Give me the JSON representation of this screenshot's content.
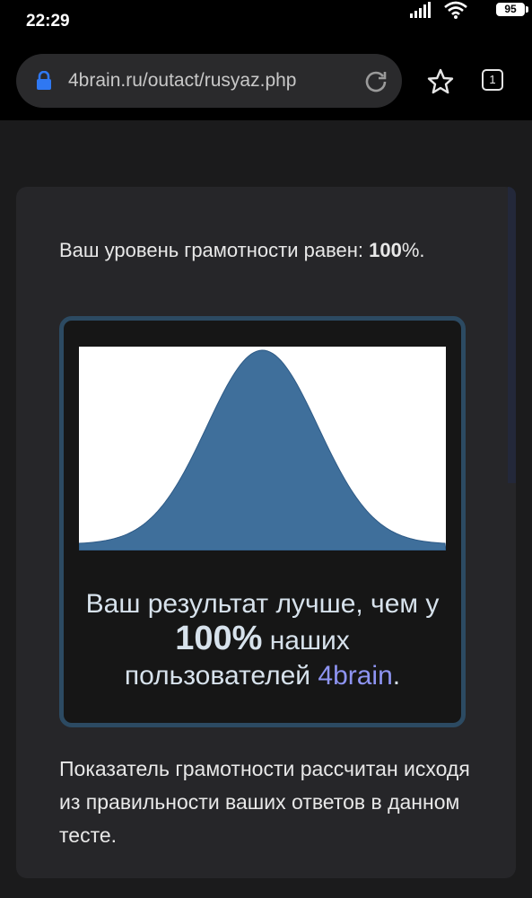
{
  "status_bar": {
    "time": "22:29",
    "battery": "95"
  },
  "browser": {
    "url": "4brain.ru/outact/rusyaz.php",
    "tab_count": "1"
  },
  "card": {
    "level_prefix": "Ваш уровень грамотности равен: ",
    "level_value": "100",
    "level_suffix": "%.",
    "result_line1": "Ваш результат лучше, чем у",
    "result_percent": "100%",
    "result_line2": "наших",
    "result_line3": "пользователей",
    "result_brand": "4brain",
    "result_end": ".",
    "explanation": "Показатель грамотности рассчитан исходя из правильности ваших ответов в данном тесте."
  },
  "colors": {
    "curve_fill": "#3f6f9b",
    "brand": "#8e94f2",
    "box_border": "#2c4a62"
  }
}
